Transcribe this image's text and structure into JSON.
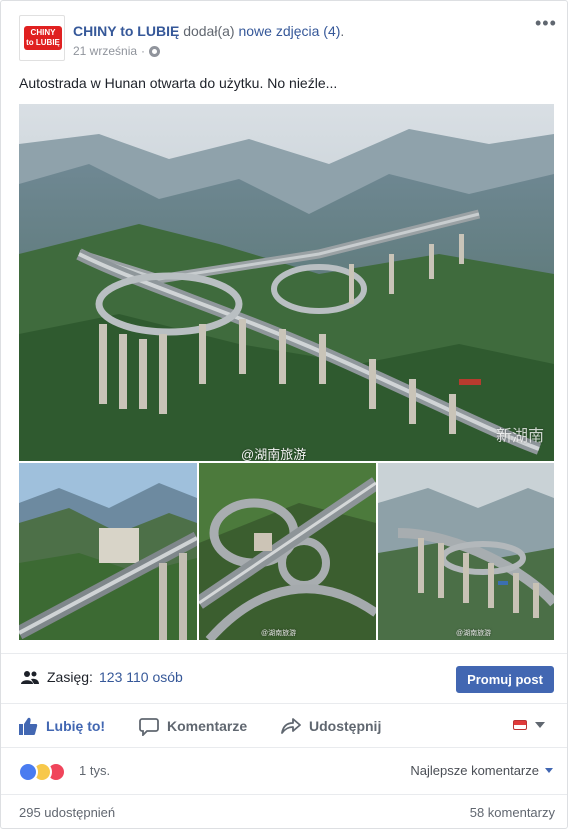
{
  "post": {
    "author": "CHINY to LUBIĘ",
    "action_text": "dodał(a)",
    "action_link": "nowe zdjęcia (4)",
    "action_end": ".",
    "date": "21 września",
    "date_sep": "·",
    "text": "Autostrada w Hunan otwarta do użytku. No nieźle...",
    "avatar_text": "CHINY to LUBIĘ",
    "more_label": "•••"
  },
  "photos": {
    "main_watermark": "@湖南旅游",
    "main_corner_mark": "新湖南",
    "small_watermark": "@湖南旅游"
  },
  "reach": {
    "label": "Zasięg:",
    "value": "123 110 osób",
    "promote_label": "Promuj post"
  },
  "actions": {
    "like": "Lubię to!",
    "comment": "Komentarze",
    "share": "Udostępnij"
  },
  "reactions": {
    "count": "1 tys.",
    "sort_label": "Najlepsze komentarze"
  },
  "stats": {
    "shares": "295 udostępnień",
    "comments": "58 komentarzy"
  },
  "colors": {
    "link": "#365899",
    "primary": "#4267b2",
    "muted": "#616770",
    "border": "#dddfe2",
    "like_blue": "#4a7cf0",
    "wow_yellow": "#f7c84a",
    "love_red": "#f0455b"
  }
}
